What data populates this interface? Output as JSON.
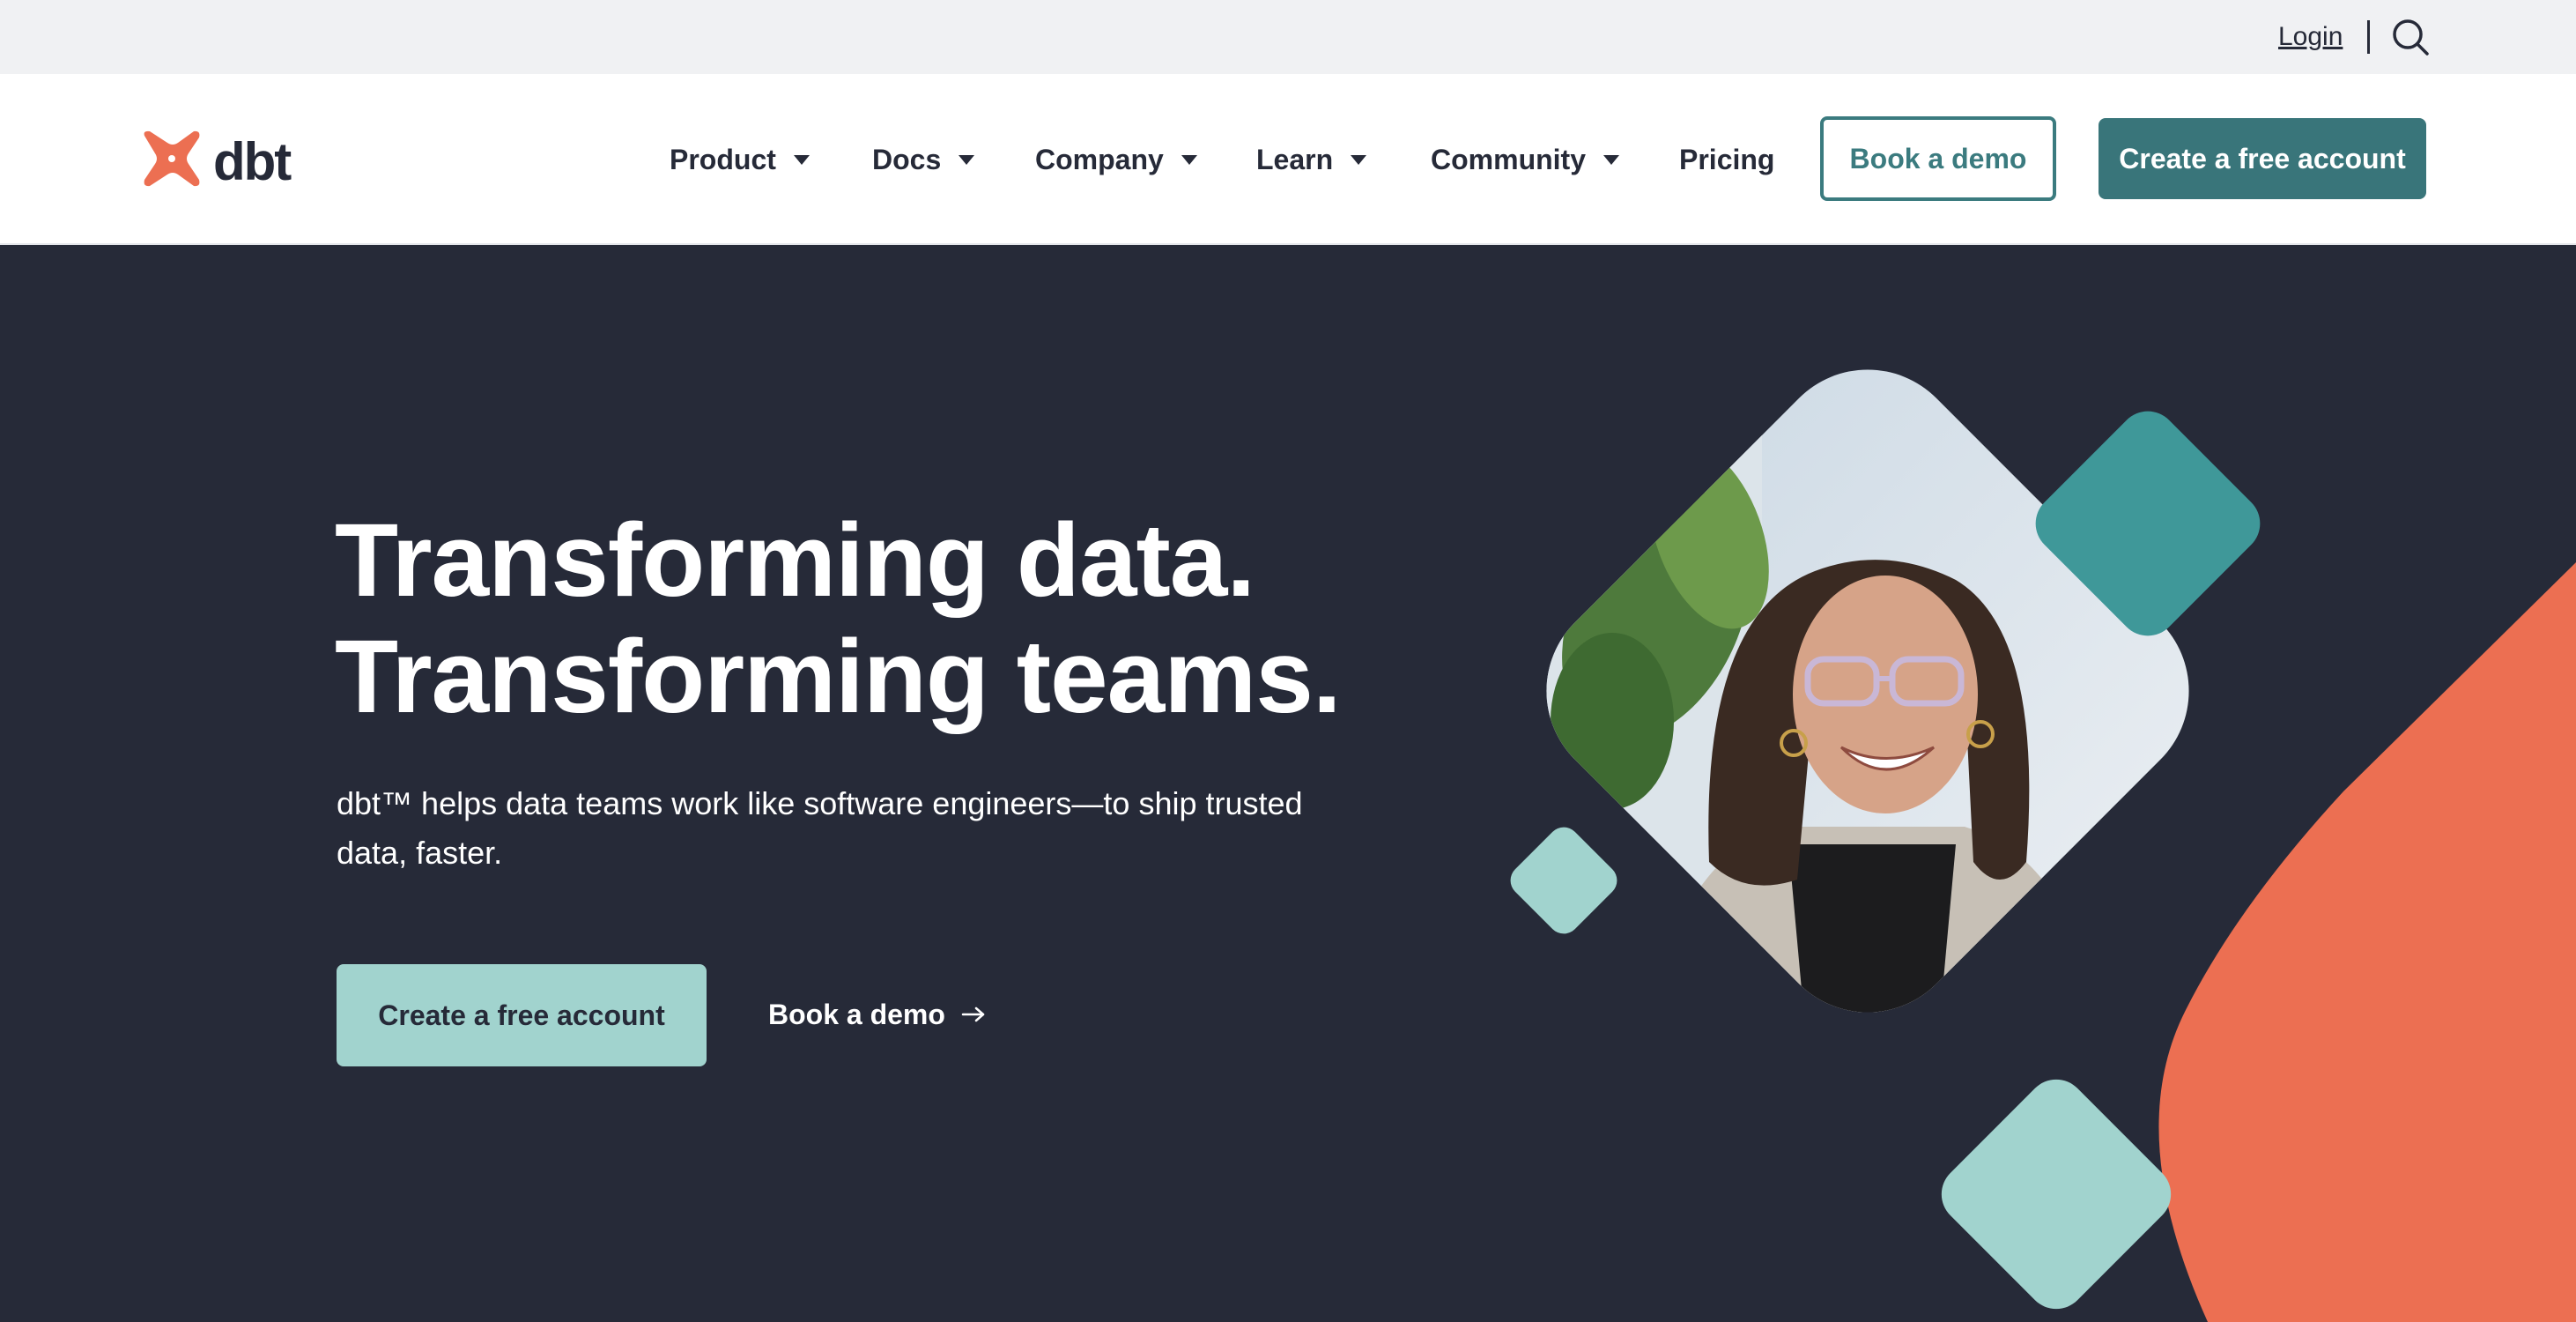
{
  "utility": {
    "login_label": "Login",
    "search_icon": "search-icon"
  },
  "nav": {
    "logo_text": "dbt",
    "items": [
      {
        "label": "Product",
        "has_dropdown": true
      },
      {
        "label": "Docs",
        "has_dropdown": true
      },
      {
        "label": "Company",
        "has_dropdown": true
      },
      {
        "label": "Learn",
        "has_dropdown": true
      },
      {
        "label": "Community",
        "has_dropdown": true
      },
      {
        "label": "Pricing",
        "has_dropdown": false
      }
    ],
    "book_demo_label": "Book a demo",
    "create_account_label": "Create a free account"
  },
  "hero": {
    "title_line1": "Transforming data.",
    "title_line2": "Transforming teams.",
    "subtitle": "dbt™ helps data teams work like software engineers—to ship trusted data, faster.",
    "cta_label": "Create a free account",
    "link_label": "Book a demo",
    "link_icon": "arrow-right-icon"
  },
  "colors": {
    "brand_orange": "#EC6F52",
    "teal_dark": "#39757A",
    "teal_mid": "#3F9899",
    "teal_light": "#A1D3CE",
    "navy": "#262A38",
    "utility_bg": "#F0F1F3"
  }
}
